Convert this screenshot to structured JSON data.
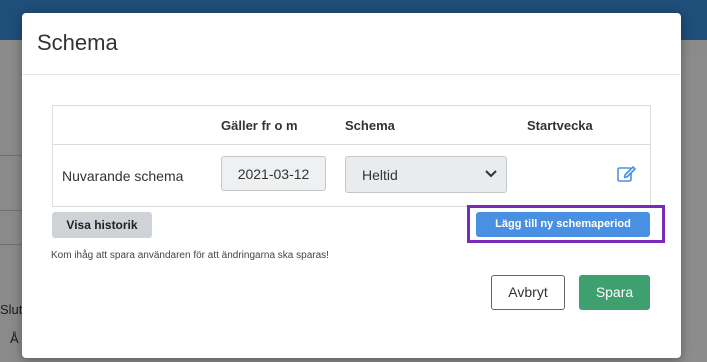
{
  "background": {
    "left_label_1": "Slut",
    "left_label_2": "Å"
  },
  "modal": {
    "title": "Schema",
    "table": {
      "headers": {
        "valid_from": "Gäller fr o m",
        "schedule": "Schema",
        "start_week": "Startvecka"
      },
      "row": {
        "label": "Nuvarande schema",
        "date": "2021-03-12",
        "schedule_value": "Heltid",
        "start_week": ""
      }
    },
    "buttons": {
      "history": "Visa historik",
      "add_period": "Lägg till ny schemaperiod",
      "cancel": "Avbryt",
      "save": "Spara"
    },
    "note": "Kom ihåg att spara användaren för att ändringarna ska sparas!"
  },
  "colors": {
    "accent_blue": "#4a90e2",
    "save_green": "#3fa06f",
    "highlight_purple": "#7a2ab8"
  },
  "icons": {
    "edit": "edit-icon",
    "chevron": "chevron-down-icon"
  }
}
